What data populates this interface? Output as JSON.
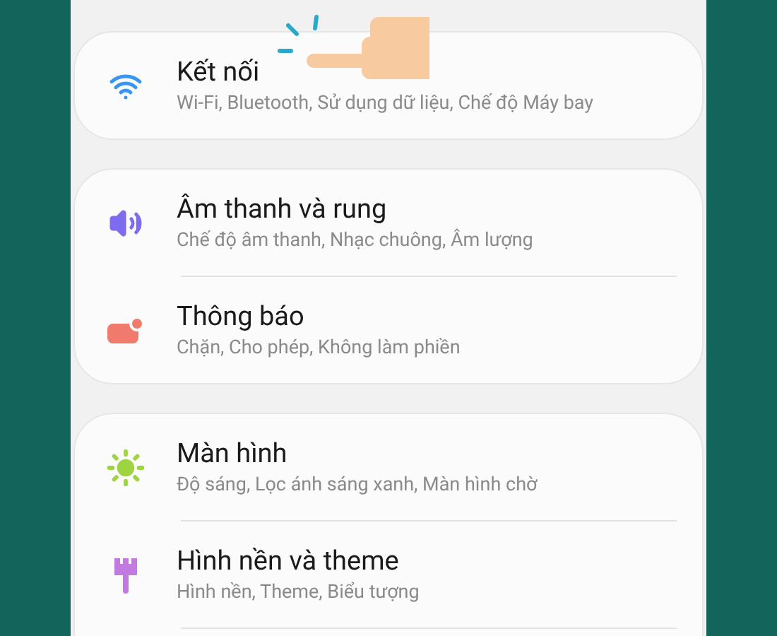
{
  "settings_groups": [
    {
      "items": [
        {
          "kind": "connections",
          "title": "Kết nối",
          "subtitle": "Wi-Fi, Bluetooth, Sử dụng dữ liệu, Chế độ Máy bay"
        }
      ]
    },
    {
      "items": [
        {
          "kind": "sound",
          "title": "Âm thanh và rung",
          "subtitle": "Chế độ âm thanh, Nhạc chuông, Âm lượng"
        },
        {
          "kind": "notifications",
          "title": "Thông báo",
          "subtitle": "Chặn, Cho phép, Không làm phiền"
        }
      ]
    },
    {
      "items": [
        {
          "kind": "display",
          "title": "Màn hình",
          "subtitle": "Độ sáng, Lọc ánh sáng xanh, Màn hình chờ"
        },
        {
          "kind": "wallpaper",
          "title": "Hình nền và theme",
          "subtitle": "Hình nền, Theme, Biểu tượng"
        }
      ]
    }
  ]
}
